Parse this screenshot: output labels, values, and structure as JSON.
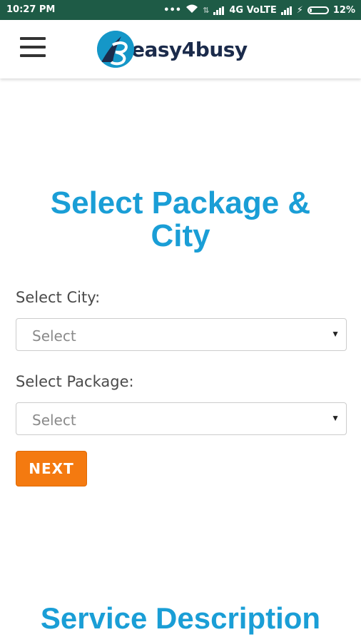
{
  "status_bar": {
    "time": "10:27 PM",
    "network": "4G VoLTE",
    "battery": "12%",
    "bg_color": "#1e5b46"
  },
  "header": {
    "logo_text": "easy4busy",
    "menu_icon": "hamburger-menu-icon"
  },
  "main": {
    "title": "Select Package & City",
    "city_label": "Select City:",
    "city_select": {
      "value": "Select"
    },
    "package_label": "Select Package:",
    "package_select": {
      "value": "Select"
    },
    "next_label": "NEXT",
    "section_title": "Service Description"
  },
  "colors": {
    "accent": "#1a9ed6",
    "button": "#f47a10",
    "logo_text": "#1b2b4b"
  }
}
